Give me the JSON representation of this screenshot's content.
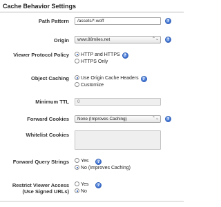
{
  "section": {
    "title": "Cache Behavior Settings"
  },
  "path_pattern": {
    "label": "Path Pattern",
    "value": "/assets/*.woff"
  },
  "origin": {
    "label": "Origin",
    "value": "www.88miles.net",
    "arrow": "⌃⌄"
  },
  "viewer_protocol_policy": {
    "label": "Viewer Protocol Policy",
    "options": [
      {
        "label": "HTTP and HTTPS",
        "checked": true
      },
      {
        "label": "HTTPS Only",
        "checked": false
      }
    ]
  },
  "object_caching": {
    "label": "Object Caching",
    "options": [
      {
        "label": "Use Origin Cache Headers",
        "checked": true
      },
      {
        "label": "Customize",
        "checked": false
      }
    ]
  },
  "minimum_ttl": {
    "label": "Minimum TTL",
    "value": "0"
  },
  "forward_cookies": {
    "label": "Forward Cookies",
    "value": "None (Improves Caching)",
    "arrow": "⌃⌄"
  },
  "whitelist_cookies": {
    "label": "Whitelist Cookies"
  },
  "forward_query_strings": {
    "label": "Forward Query Strings",
    "options": [
      {
        "label": "Yes",
        "checked": false
      },
      {
        "label": "No (Improves Caching)",
        "checked": true
      }
    ]
  },
  "restrict_viewer_access": {
    "label_line1": "Restrict Viewer Access",
    "label_line2": "(Use Signed URLs)",
    "options": [
      {
        "label": "Yes",
        "checked": false
      },
      {
        "label": "No",
        "checked": true
      }
    ]
  },
  "icons": {
    "info": "info-icon",
    "select_arrow": "chevron-updown-icon"
  },
  "colors": {
    "info_icon": "#3b6fd0",
    "radio_selected": "#1a4fb8"
  }
}
